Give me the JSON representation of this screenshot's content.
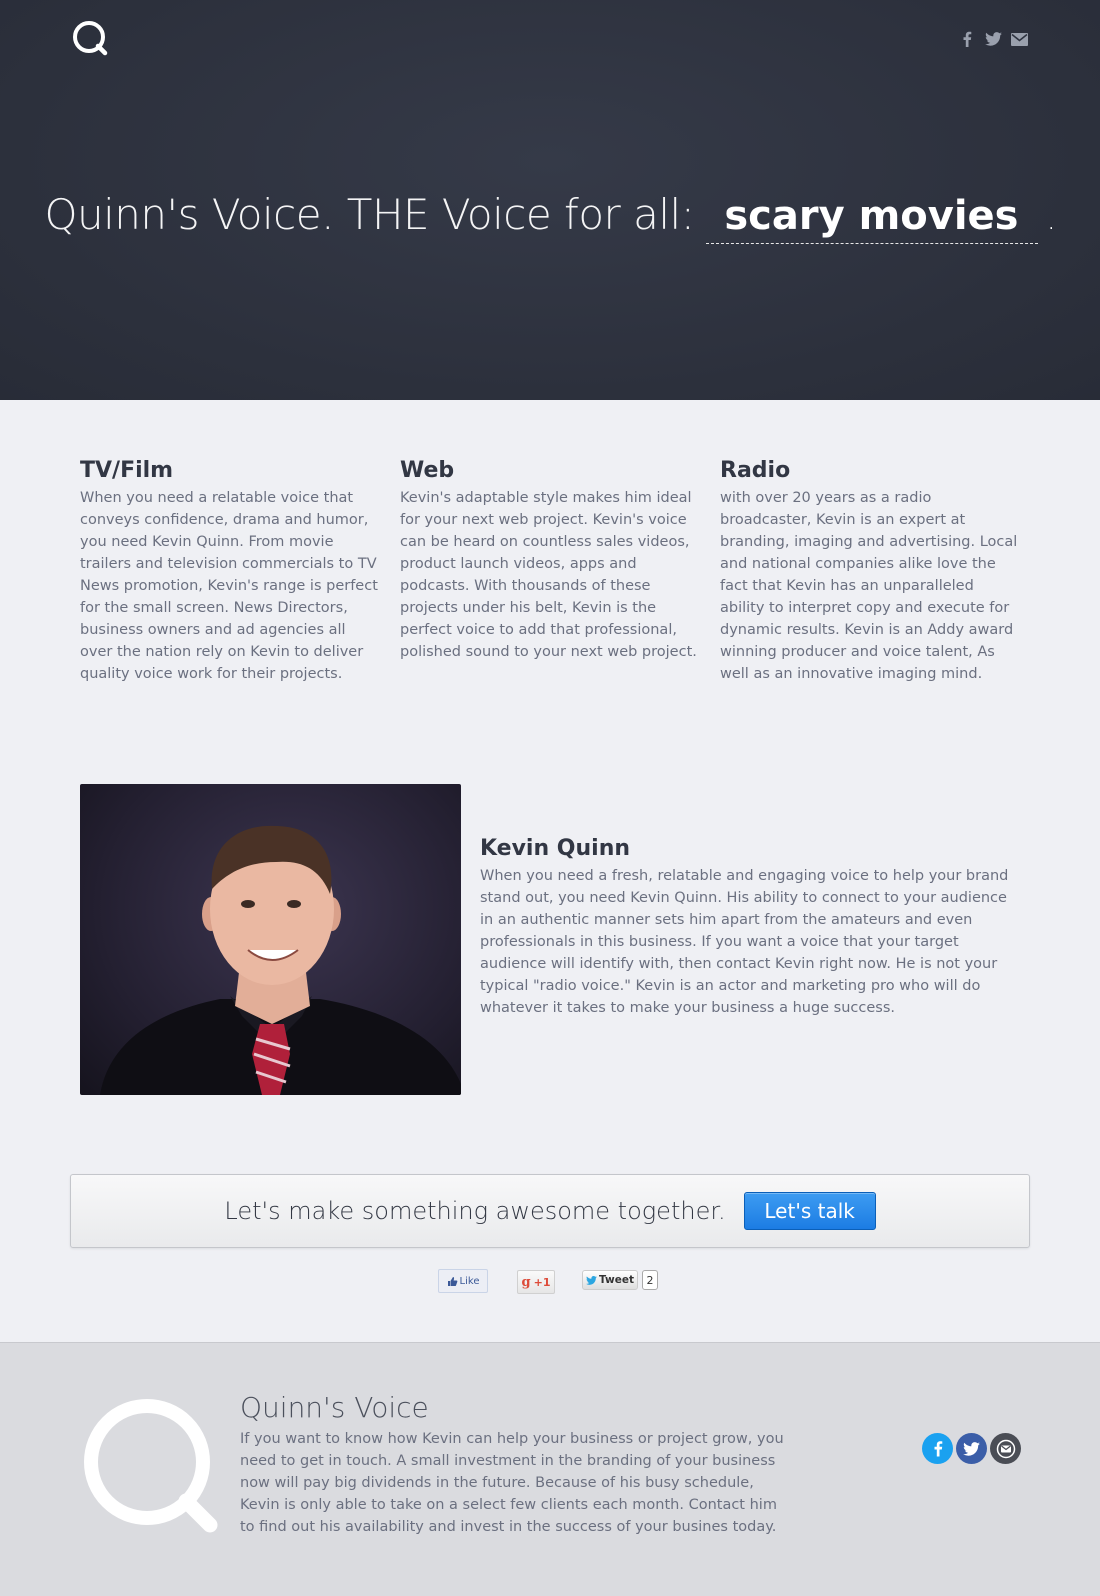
{
  "hero": {
    "prefix": "Quinn's Voice. THE Voice for all:",
    "rotating_word": "scary movies",
    "suffix": "."
  },
  "header_social": [
    {
      "icon": "facebook-icon"
    },
    {
      "icon": "twitter-icon"
    },
    {
      "icon": "mail-icon"
    }
  ],
  "services": [
    {
      "title": "TV/Film",
      "body": "When you need a relatable voice that conveys confidence, drama and humor, you need Kevin Quinn. From movie trailers and television commercials to TV News promotion, Kevin's range is perfect for the small screen. News Directors, business owners and ad agencies all over the nation rely on Kevin to deliver quality voice work for their projects."
    },
    {
      "title": "Web",
      "body": "Kevin's adaptable style makes him ideal for your next web project. Kevin's voice can be heard on countless sales videos, product launch videos, apps and podcasts. With thousands of these projects under his belt, Kevin is the perfect voice to add that professional, polished sound to your next web project."
    },
    {
      "title": "Radio",
      "body": "with over 20 years as a radio broadcaster, Kevin is an expert at branding, imaging and advertising. Local and national companies alike love the fact that Kevin has an unparalleled ability to interpret copy and execute for dynamic results. Kevin is an Addy award winning producer and voice talent, As well as an innovative imaging mind."
    }
  ],
  "bio": {
    "name": "Kevin Quinn",
    "body": "When you need a fresh, relatable and engaging voice to help your brand stand out, you need Kevin Quinn. His ability to connect to your audience in an authentic manner sets him apart from the amateurs and even professionals in this business. If you want a voice that your target audience will identify with, then contact Kevin right now. He is not your typical \"radio voice.\" Kevin is an actor and marketing pro who will do whatever it takes to make your business a huge success."
  },
  "cta": {
    "text": "Let's make something awesome together.",
    "button": "Let's talk"
  },
  "share": {
    "like_label": "Like",
    "gplus_label": "+1",
    "tweet_label": "Tweet",
    "tweet_count": "2"
  },
  "footer": {
    "title": "Quinn's Voice",
    "body": "If you want to know how Kevin can help your business or project grow, you need to get in touch. A small investment in the branding of your business now will pay big dividends in the future. Because of his busy schedule, Kevin is only able to take on a select few clients each month. Contact him to find out his availability and invest in the success of your busines today."
  },
  "colors": {
    "hero_bg": "#2e3340",
    "page_bg": "#eff0f4",
    "footer_bg": "#dadbdf",
    "cta_button": "#1c7ce3",
    "facebook": "#1aa1f0",
    "twitter": "#3b5ea8",
    "mail": "#4a4d55"
  }
}
